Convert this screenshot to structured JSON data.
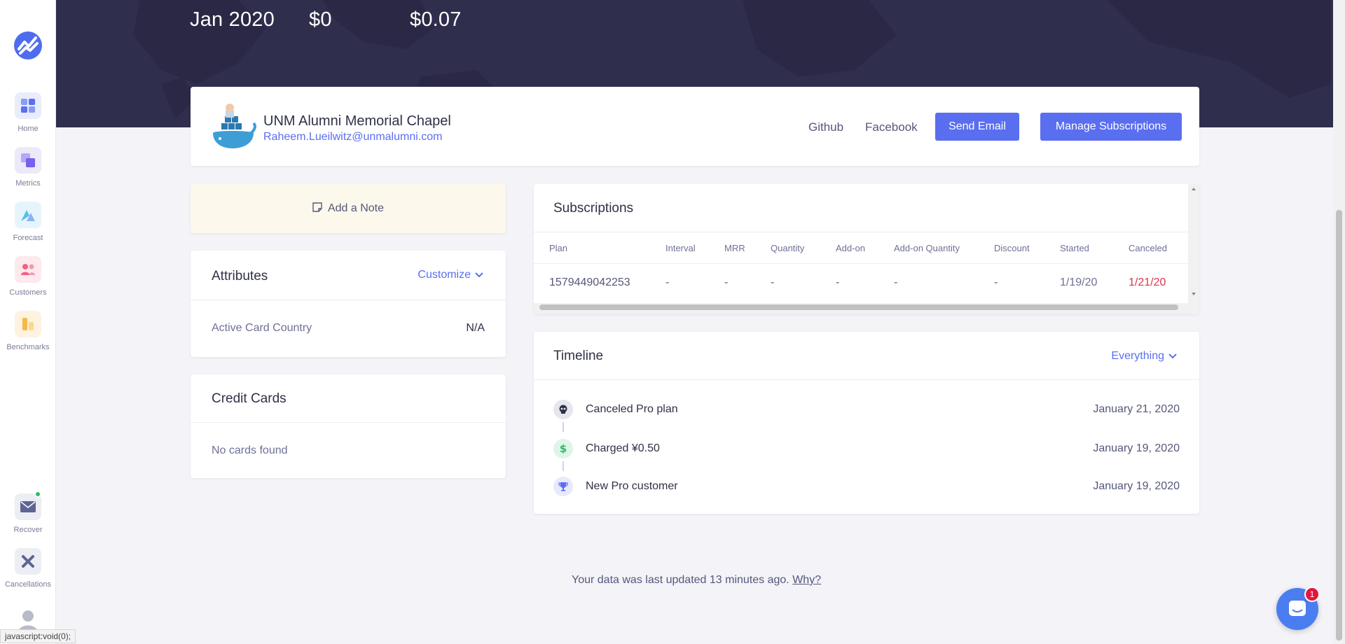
{
  "sidebar": {
    "items": [
      {
        "label": "Home",
        "icon": "home-icon"
      },
      {
        "label": "Metrics",
        "icon": "metrics-icon"
      },
      {
        "label": "Forecast",
        "icon": "forecast-icon"
      },
      {
        "label": "Customers",
        "icon": "customers-icon"
      },
      {
        "label": "Benchmarks",
        "icon": "benchmarks-icon"
      },
      {
        "label": "Recover",
        "icon": "recover-mail-icon"
      },
      {
        "label": "Cancellations",
        "icon": "cancellations-icon"
      }
    ]
  },
  "hero": {
    "stats": [
      "Jan 2020",
      "$0",
      "$0.07"
    ]
  },
  "profile": {
    "name": "UNM Alumni Memorial Chapel",
    "email": "Raheem.Lueilwitz@unmalumni.com",
    "links": [
      "Github",
      "Facebook"
    ],
    "send_email_label": "Send Email",
    "manage_subscriptions_label": "Manage Subscriptions"
  },
  "note": {
    "label": "Add a Note"
  },
  "attributes": {
    "title": "Attributes",
    "customize_label": "Customize",
    "rows": [
      {
        "label": "Active Card Country",
        "value": "N/A"
      }
    ]
  },
  "credit_cards": {
    "title": "Credit Cards",
    "empty_text": "No cards found"
  },
  "subscriptions": {
    "title": "Subscriptions",
    "columns": [
      "Plan",
      "Interval",
      "MRR",
      "Quantity",
      "Add-on",
      "Add-on Quantity",
      "Discount",
      "Started",
      "Canceled"
    ],
    "rows": [
      [
        "1579449042253",
        "-",
        "-",
        "-",
        "-",
        "-",
        "-",
        "1/19/20",
        "1/21/20"
      ]
    ]
  },
  "timeline": {
    "title": "Timeline",
    "filter_label": "Everything",
    "events": [
      {
        "text": "Canceled Pro plan",
        "date": "January 21, 2020",
        "icon": "skull-icon"
      },
      {
        "text": "Charged ¥0.50",
        "date": "January 19, 2020",
        "icon": "dollar-icon"
      },
      {
        "text": "New Pro customer",
        "date": "January 19, 2020",
        "icon": "trophy-icon"
      }
    ]
  },
  "footer": {
    "text": "Your data was last updated 13 minutes ago.",
    "link": "Why?"
  },
  "chat": {
    "badge": "1"
  },
  "statusbar": {
    "text": "javascript:void(0);"
  },
  "colors": {
    "accent": "#5a6ef0",
    "hero_bg": "#302e4d",
    "canceled_red": "#e0344f",
    "note_bg": "#fdf8ec"
  }
}
